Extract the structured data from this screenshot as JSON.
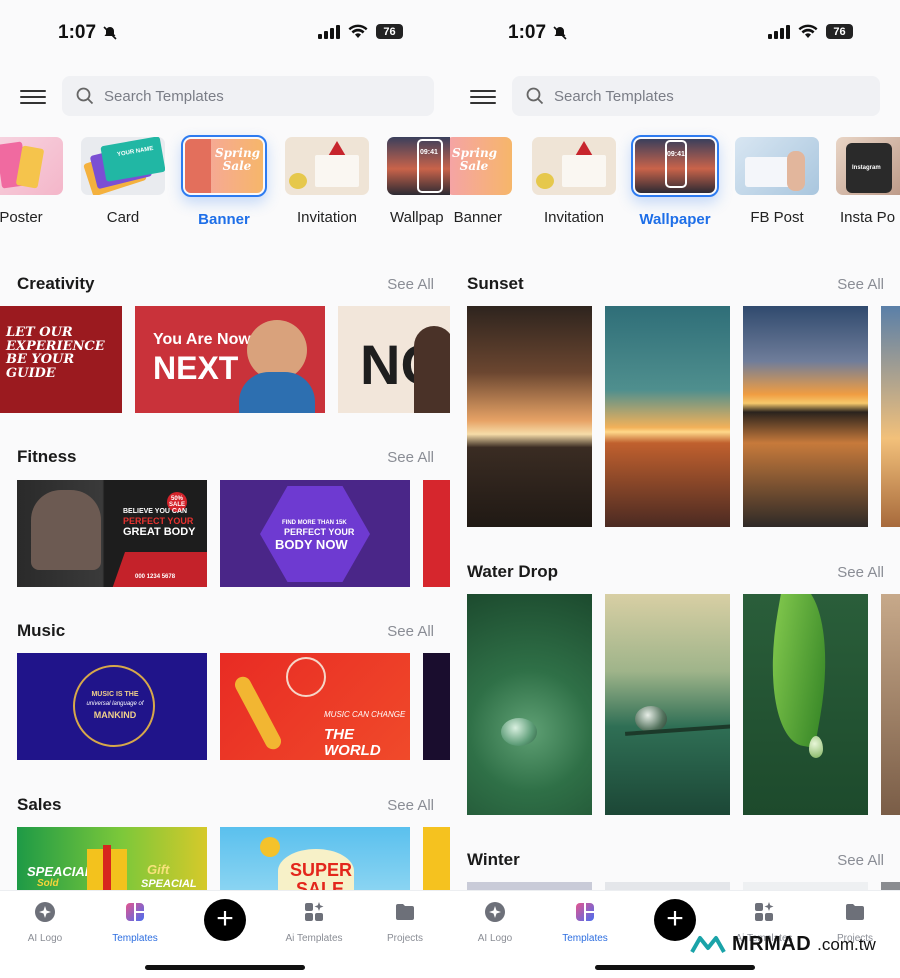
{
  "status": {
    "time": "1:07",
    "battery": "76"
  },
  "search": {
    "placeholder": "Search Templates"
  },
  "left": {
    "categories": [
      {
        "label": "Poster"
      },
      {
        "label": "Card"
      },
      {
        "label": "Banner"
      },
      {
        "label": "Invitation"
      },
      {
        "label": "Wallpap"
      }
    ],
    "sections": [
      {
        "title": "Creativity",
        "see_all": "See All"
      },
      {
        "title": "Fitness",
        "see_all": "See All"
      },
      {
        "title": "Music",
        "see_all": "See All"
      },
      {
        "title": "Sales",
        "see_all": "See All"
      }
    ],
    "thumb_text": {
      "card_name": "YOUR NAME",
      "spring_sale": "Spring Sale",
      "phone_time": "09:41",
      "creativity1": "LET OUR EXPERIENCE BE YOUR GUIDE",
      "creativity2_top": "You Are Now",
      "creativity2_big": "NEXT",
      "creativity3": "NO",
      "fitness1_a": "50% SALE",
      "fitness1_b": "BELIEVE YOU CAN",
      "fitness1_c": "PERFECT YOUR",
      "fitness1_d": "GREAT BODY",
      "fitness1_phone": "000 1234 5678",
      "fitness2_a": "FIND MORE THAN 15K",
      "fitness2_b": "PERFECT YOUR",
      "fitness2_c": "BODY NOW",
      "music1_a": "MUSIC IS THE",
      "music1_b": "universal language of",
      "music1_c": "MANKIND",
      "music2_a": "MUSIC CAN CHANGE",
      "music2_b": "THE WORLD",
      "sales1_a": "SPEACIAL",
      "sales1_b": "Sold",
      "sales1_c": "Gift",
      "sales1_d": "SPEACIAL",
      "sales2": "SUPER SALE"
    }
  },
  "right": {
    "categories": [
      {
        "label": "Banner"
      },
      {
        "label": "Invitation"
      },
      {
        "label": "Wallpaper"
      },
      {
        "label": "FB Post"
      },
      {
        "label": "Insta Po"
      }
    ],
    "sections": [
      {
        "title": "Sunset",
        "see_all": "See All"
      },
      {
        "title": "Water Drop",
        "see_all": "See All"
      },
      {
        "title": "Winter",
        "see_all": "See All"
      }
    ],
    "thumb_text": {
      "insta": "Instagram"
    }
  },
  "tabs": [
    {
      "label": "AI Logo",
      "icon": "ai-logo-icon"
    },
    {
      "label": "Templates",
      "icon": "templates-icon"
    },
    {
      "label": "Ai Templates",
      "icon": "ai-templates-icon"
    },
    {
      "label": "Projects",
      "icon": "folder-icon"
    }
  ],
  "create_button": "+",
  "watermark": {
    "brand": "MRMAD",
    "domain": ".com.tw"
  },
  "colors": {
    "accent": "#1e6fe8",
    "background": "#fafafb"
  }
}
